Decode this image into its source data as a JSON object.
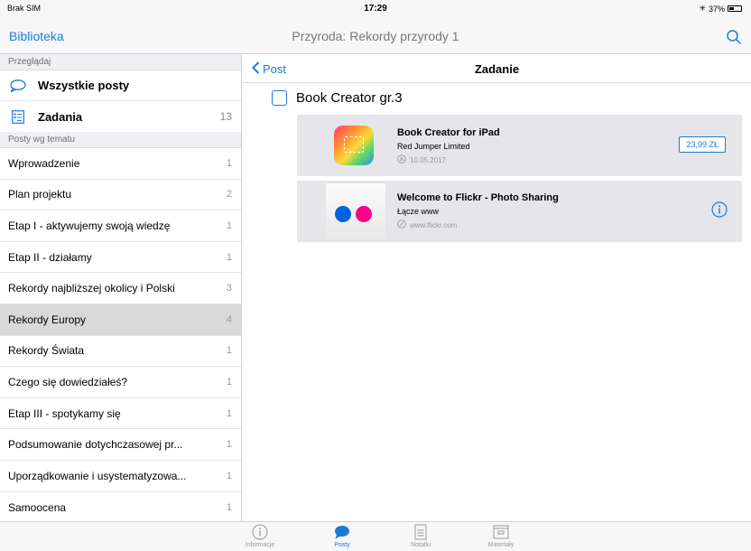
{
  "status": {
    "carrier": "Brak SIM",
    "time": "17:29",
    "battery": "37%",
    "battery_level": 0.37
  },
  "nav": {
    "left_label": "Biblioteka",
    "title": "Przyroda: Rekordy przyrody 1"
  },
  "sidebar": {
    "browse_header": "Przeglądaj",
    "all_posts": "Wszystkie posty",
    "tasks": {
      "label": "Zadania",
      "count": "13"
    },
    "topics_header": "Posty wg tematu",
    "items": [
      {
        "label": "Wprowadzenie",
        "count": "1"
      },
      {
        "label": "Plan projektu",
        "count": "2"
      },
      {
        "label": "Etap I - aktywujemy swoją wiedzę",
        "count": "1"
      },
      {
        "label": "Etap II - działamy",
        "count": "1"
      },
      {
        "label": "Rekordy najbliższej okolicy i Polski",
        "count": "3"
      },
      {
        "label": "Rekordy Europy",
        "count": "4"
      },
      {
        "label": "Rekordy Świata",
        "count": "1"
      },
      {
        "label": "Czego się dowiedziałeś?",
        "count": "1"
      },
      {
        "label": "Etap III - spotykamy się",
        "count": "1"
      },
      {
        "label": "Podsumowanie dotychczasowej pr...",
        "count": "1"
      },
      {
        "label": "Uporządkowanie i usystematyzowa...",
        "count": "1"
      },
      {
        "label": "Samoocena",
        "count": "1"
      }
    ]
  },
  "detail": {
    "back_label": "Post",
    "title": "Zadanie",
    "task_label": "Book Creator gr.3",
    "cards": [
      {
        "title": "Book Creator for iPad",
        "subtitle": "Red Jumper Limited",
        "meta": "10.05.2017",
        "action": "23,99 ZŁ",
        "icon": "book-creator-app-icon"
      },
      {
        "title": "Welcome to Flickr - Photo Sharing",
        "subtitle": "Łącze www",
        "meta": "www.flickr.com",
        "icon": "flickr-thumbnail"
      }
    ]
  },
  "tabs": [
    {
      "label": "Informacje",
      "icon": "info-icon"
    },
    {
      "label": "Posty",
      "icon": "speech-bubble-icon"
    },
    {
      "label": "Notatki",
      "icon": "note-icon"
    },
    {
      "label": "Materiały",
      "icon": "box-icon"
    }
  ],
  "colors": {
    "accent": "#1a7bd6",
    "selected_row": "#d9d9d9",
    "card_bg": "#e5e5ea"
  }
}
